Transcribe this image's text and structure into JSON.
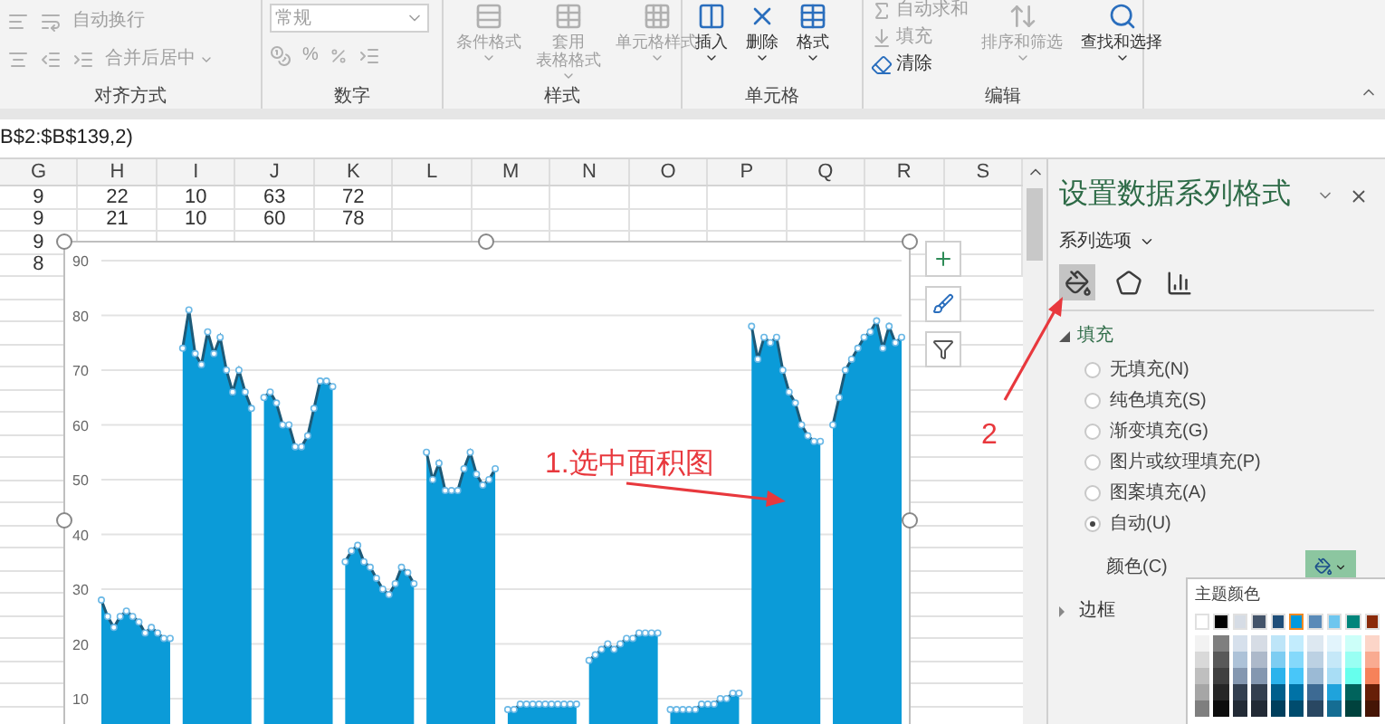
{
  "ribbon": {
    "alignment": {
      "label": "对齐方式",
      "wrap_text": {
        "label": "自动换行",
        "disabled": true
      },
      "merge_center": {
        "label": "合并后居中",
        "disabled": true
      }
    },
    "number": {
      "label": "数字",
      "format": {
        "value": "常规",
        "disabled": true
      },
      "percent": {
        "label": "%",
        "disabled": true
      }
    },
    "styles": {
      "label": "样式",
      "buttons": [
        {
          "kind": "conditional",
          "lines": [
            "条件格式"
          ],
          "disabled": true
        },
        {
          "kind": "table",
          "lines": [
            "套用",
            "表格格式"
          ],
          "disabled": true
        },
        {
          "kind": "cell",
          "lines": [
            "单元格样式"
          ],
          "disabled": true
        }
      ]
    },
    "cells": {
      "label": "单元格",
      "buttons": [
        {
          "kind": "insert",
          "label": "插入",
          "disabled": false
        },
        {
          "kind": "delete",
          "label": "删除",
          "disabled": false
        },
        {
          "kind": "format",
          "label": "格式",
          "disabled": false
        }
      ]
    },
    "editing": {
      "label": "编辑",
      "small": [
        {
          "kind": "sum",
          "label": "自动求和",
          "disabled": true
        },
        {
          "kind": "fill",
          "label": "填充",
          "disabled": true
        },
        {
          "kind": "clear",
          "label": "清除",
          "disabled": false
        }
      ],
      "buttons": [
        {
          "kind": "sort",
          "label": "排序和筛选",
          "disabled": true
        },
        {
          "kind": "find",
          "label": "查找和选择",
          "disabled": false
        }
      ]
    }
  },
  "formula_bar": {
    "value": "B$2:$B$139,2)"
  },
  "sheet": {
    "columns": [
      "G",
      "H",
      "I",
      "J",
      "K",
      "L",
      "M",
      "N",
      "O",
      "P",
      "Q",
      "R",
      "S"
    ],
    "rows": [
      {
        "cells": [
          "9",
          "22",
          "10",
          "63",
          "72"
        ]
      },
      {
        "cells": [
          "9",
          "21",
          "10",
          "60",
          "78"
        ]
      },
      {
        "cells": [
          "9"
        ]
      },
      {
        "cells": [
          "8"
        ]
      }
    ]
  },
  "chart": {
    "chart_data": {
      "type": "area",
      "grid": true,
      "ylim": [
        0,
        90
      ],
      "yticks": [
        10,
        20,
        30,
        40,
        50,
        60,
        70,
        80,
        90
      ],
      "annotations": [
        {
          "text": "1.选中面积图"
        }
      ],
      "series": [
        {
          "color": "#0b9bd8",
          "values": [
            28,
            25,
            23,
            25,
            26,
            25,
            24,
            22,
            23,
            22,
            21,
            21,
            null,
            74,
            81,
            73,
            71,
            77,
            73,
            76,
            70,
            66,
            70,
            66,
            63,
            null,
            65,
            66,
            64,
            60,
            60,
            56,
            56,
            58,
            63,
            68,
            68,
            67,
            null,
            35,
            37,
            38,
            35,
            34,
            32,
            30,
            29,
            31,
            34,
            33,
            31,
            null,
            55,
            50,
            53,
            48,
            48,
            48,
            52,
            55,
            51,
            49,
            50,
            52,
            null,
            8,
            8,
            9,
            9,
            9,
            9,
            9,
            9,
            9,
            9,
            9,
            9,
            null,
            17,
            18,
            19,
            20,
            19,
            20,
            21,
            21,
            22,
            22,
            22,
            22,
            null,
            8,
            8,
            8,
            8,
            8,
            9,
            9,
            9,
            10,
            10,
            11,
            11,
            null,
            78,
            72,
            76,
            75,
            76,
            70,
            66,
            64,
            60,
            58,
            57,
            57,
            null,
            60,
            65,
            70,
            72,
            74,
            76,
            77,
            79,
            74,
            78,
            75,
            76
          ]
        }
      ]
    }
  },
  "callout": {
    "text": "2"
  },
  "panel": {
    "title": "设置数据系列格式",
    "section_menu": "系列选项",
    "tabs": [
      {
        "kind": "fill",
        "selected": true
      },
      {
        "kind": "effects",
        "selected": false
      },
      {
        "kind": "series",
        "selected": false
      }
    ],
    "fill": {
      "label": "填充",
      "expanded": true,
      "options": [
        {
          "label": "无填充(N)",
          "selected": false
        },
        {
          "label": "纯色填充(S)",
          "selected": false
        },
        {
          "label": "渐变填充(G)",
          "selected": false
        },
        {
          "label": "图片或纹理填充(P)",
          "selected": false
        },
        {
          "label": "图案填充(A)",
          "selected": false
        },
        {
          "label": "自动(U)",
          "selected": true
        }
      ],
      "color_label": "颜色(C)"
    },
    "border": {
      "label": "边框",
      "expanded": false
    }
  },
  "palette": {
    "title": "主题颜色",
    "theme": [
      {
        "color": "#ffffff",
        "selected": false
      },
      {
        "color": "#000000",
        "selected": false
      },
      {
        "color": "#d6dce5",
        "selected": false
      },
      {
        "color": "#44546a",
        "selected": false
      },
      {
        "color": "#1f4e79",
        "selected": false
      },
      {
        "color": "#0099dd",
        "selected": true
      },
      {
        "color": "#5a8ab8",
        "selected": false
      },
      {
        "color": "#6ec6ef",
        "selected": false
      },
      {
        "color": "#00857b",
        "selected": false
      },
      {
        "color": "#8a2a0a",
        "selected": false
      }
    ],
    "shades": [
      {
        "swatches": [
          {
            "color": "#f2f2f2"
          },
          {
            "color": "#7f7f7f"
          },
          {
            "color": "#d6e0ec"
          },
          {
            "color": "#d6dce5"
          },
          {
            "color": "#bde5f8"
          },
          {
            "color": "#c2ecfd"
          },
          {
            "color": "#dde8f1"
          },
          {
            "color": "#e2f4fc"
          },
          {
            "color": "#ccfff9"
          },
          {
            "color": "#fcd5c8"
          }
        ]
      },
      {
        "swatches": [
          {
            "color": "#d9d9d9"
          },
          {
            "color": "#595959"
          },
          {
            "color": "#adc2d8"
          },
          {
            "color": "#adb9ca"
          },
          {
            "color": "#7dcdf2"
          },
          {
            "color": "#85d9fb"
          },
          {
            "color": "#bcd1e3"
          },
          {
            "color": "#c5e8f8"
          },
          {
            "color": "#99fff3"
          },
          {
            "color": "#f9ab91"
          }
        ]
      },
      {
        "swatches": [
          {
            "color": "#bfbfbf"
          },
          {
            "color": "#404040"
          },
          {
            "color": "#8497b0"
          },
          {
            "color": "#8497b0"
          },
          {
            "color": "#2bb3ec"
          },
          {
            "color": "#48c6f9"
          },
          {
            "color": "#9bbad5"
          },
          {
            "color": "#a8ddf5"
          },
          {
            "color": "#66ffed"
          },
          {
            "color": "#f6825a"
          }
        ]
      },
      {
        "swatches": [
          {
            "color": "#a6a6a6"
          },
          {
            "color": "#262626"
          },
          {
            "color": "#333f50"
          },
          {
            "color": "#333f4f"
          },
          {
            "color": "#005f8c"
          },
          {
            "color": "#0072a6"
          },
          {
            "color": "#3d6a93"
          },
          {
            "color": "#1fa3dc"
          },
          {
            "color": "#00635c"
          },
          {
            "color": "#671f07"
          }
        ]
      },
      {
        "swatches": [
          {
            "color": "#7f7f7f"
          },
          {
            "color": "#0d0d0d"
          },
          {
            "color": "#222a35"
          },
          {
            "color": "#222a35"
          },
          {
            "color": "#003f5d"
          },
          {
            "color": "#004c6e"
          },
          {
            "color": "#294762"
          },
          {
            "color": "#156d93"
          },
          {
            "color": "#00423d"
          },
          {
            "color": "#451505"
          }
        ]
      }
    ]
  }
}
